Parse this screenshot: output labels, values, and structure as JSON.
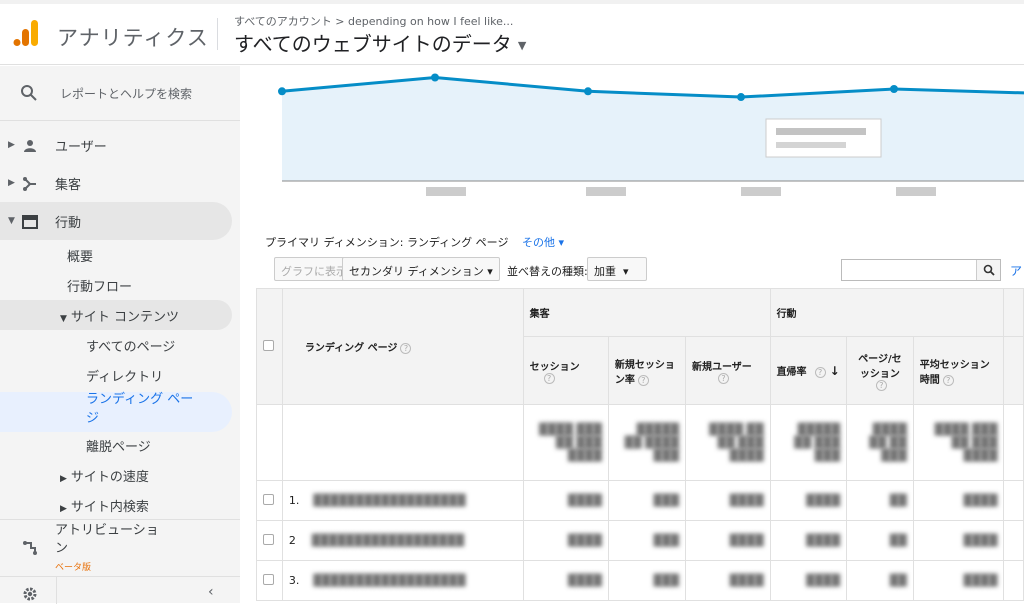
{
  "header": {
    "app_title": "アナリティクス",
    "account_path": "すべてのアカウント > depending on how I feel like...",
    "view_title": "すべてのウェブサイトのデータ",
    "brand_colors": {
      "logo_orange": "#f9ab00",
      "logo_dark": "#e37400"
    }
  },
  "sidebar": {
    "search_placeholder": "レポートとヘルプを検索",
    "items": [
      {
        "label": "ユーザー",
        "icon": "person-icon"
      },
      {
        "label": "集客",
        "icon": "acquisition-icon"
      },
      {
        "label": "行動",
        "icon": "behavior-icon"
      }
    ],
    "behavior_sub": [
      "概要",
      "行動フロー",
      "サイト コンテンツ"
    ],
    "site_content_sub": [
      "すべてのページ",
      "ディレクトリ",
      "ランディング ペー\nジ",
      "離脱ページ"
    ],
    "more": [
      "サイトの速度",
      "サイト内検索"
    ],
    "attribution": "アトリビューショ\nン",
    "beta": "ベータ版"
  },
  "chart_data": {
    "type": "area",
    "title": "",
    "xlabel": "",
    "ylabel": "",
    "x": [
      1,
      2,
      3,
      4,
      5,
      6
    ],
    "series": [
      {
        "values": [
          0.78,
          0.9,
          0.78,
          0.73,
          0.8,
          0.76
        ]
      }
    ],
    "ylim": [
      0,
      1
    ],
    "grid": true,
    "colors": {
      "line": "#058dc7",
      "fill": "#e6f2fa"
    }
  },
  "report": {
    "primary_dimension_label": "プライマリ ディメンション:",
    "primary_dimension": "ランディング ページ",
    "other": "その他",
    "graph_button": "グラフに表示",
    "secondary_dimension": "セカンダリ ディメンション",
    "sort_label": "並べ替えの種類:",
    "sort_value": "加重",
    "search_placeholder": "",
    "more_link": "ア",
    "groups": {
      "acquisition": "集客",
      "behavior": "行動"
    },
    "columns": {
      "landing_page": "ランディング ページ",
      "sessions": "セッション",
      "new_session_rate": "新規セッショ\nン率",
      "new_users": "新規ユーザー",
      "bounce_rate": "直帰率",
      "pages_per_session": "ページ/セ\nッション",
      "avg_session_duration": "平均セッション\n時間"
    },
    "rows": [
      {
        "index": "1."
      },
      {
        "index": "2"
      },
      {
        "index": "3."
      }
    ]
  }
}
